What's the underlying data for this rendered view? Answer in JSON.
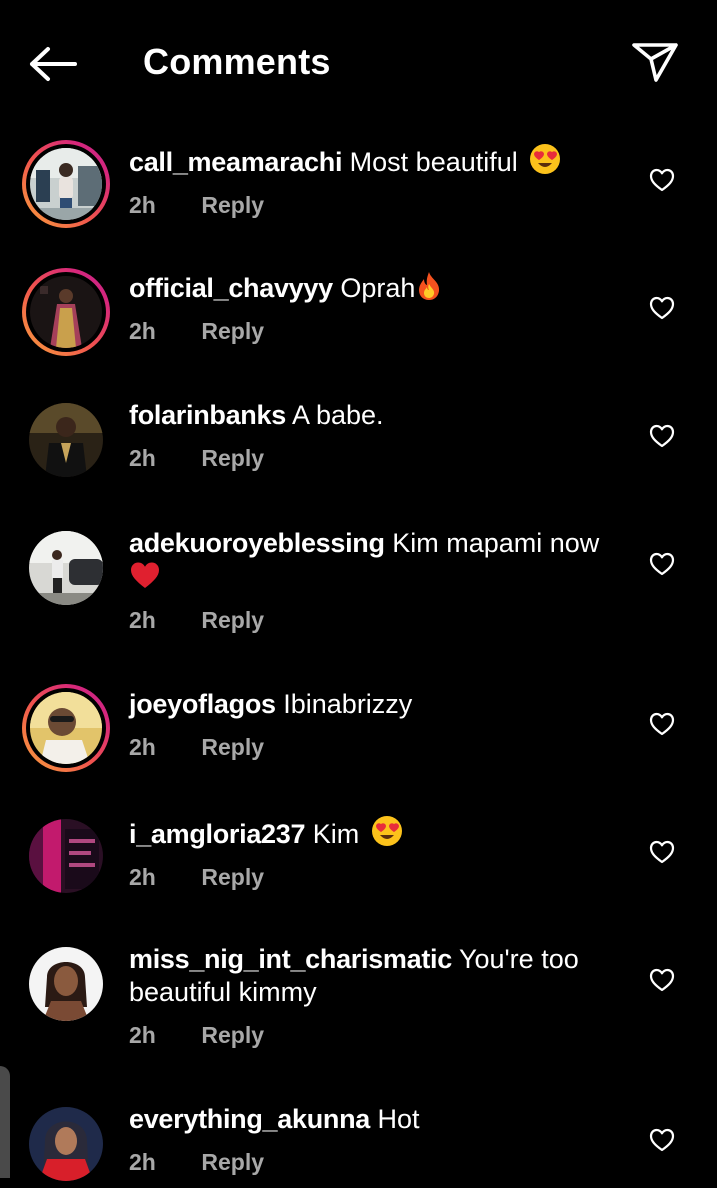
{
  "header": {
    "title": "Comments",
    "back_icon": "arrow-left-icon",
    "send_icon": "paper-plane-icon"
  },
  "colors": {
    "background": "#000000",
    "text": "#ffffff",
    "meta": "#a8a8a8",
    "story_ring_start": "#f9a23c",
    "story_ring_end": "#b82a8e"
  },
  "comments": [
    {
      "username": "call_meamarachi",
      "text": "Most beautiful",
      "emoji": "heart-eyes-emoji",
      "time": "2h",
      "reply": "Reply",
      "story_ring": true
    },
    {
      "username": "official_chavyyy",
      "text": "Oprah",
      "emoji": "fire-emoji",
      "time": "2h",
      "reply": "Reply",
      "story_ring": true
    },
    {
      "username": "folarinbanks",
      "text": "A babe.",
      "time": "2h",
      "reply": "Reply",
      "story_ring": false
    },
    {
      "username": "adekuoroyeblessing",
      "text": "Kim mapami now",
      "emoji": "red-heart-emoji",
      "time": "2h",
      "reply": "Reply",
      "story_ring": false
    },
    {
      "username": "joeyoflagos",
      "text": "Ibinabrizzy",
      "time": "2h",
      "reply": "Reply",
      "story_ring": true
    },
    {
      "username": "i_amgloria237",
      "text": "Kim",
      "emoji": "heart-eyes-emoji",
      "time": "2h",
      "reply": "Reply",
      "story_ring": false
    },
    {
      "username": "miss_nig_int_charismatic",
      "text": "You're too",
      "text_line2": "beautiful kimmy",
      "time": "2h",
      "reply": "Reply",
      "story_ring": false
    },
    {
      "username": "everything_akunna",
      "text": "Hot",
      "time": "2h",
      "reply": "Reply",
      "story_ring": false
    }
  ]
}
